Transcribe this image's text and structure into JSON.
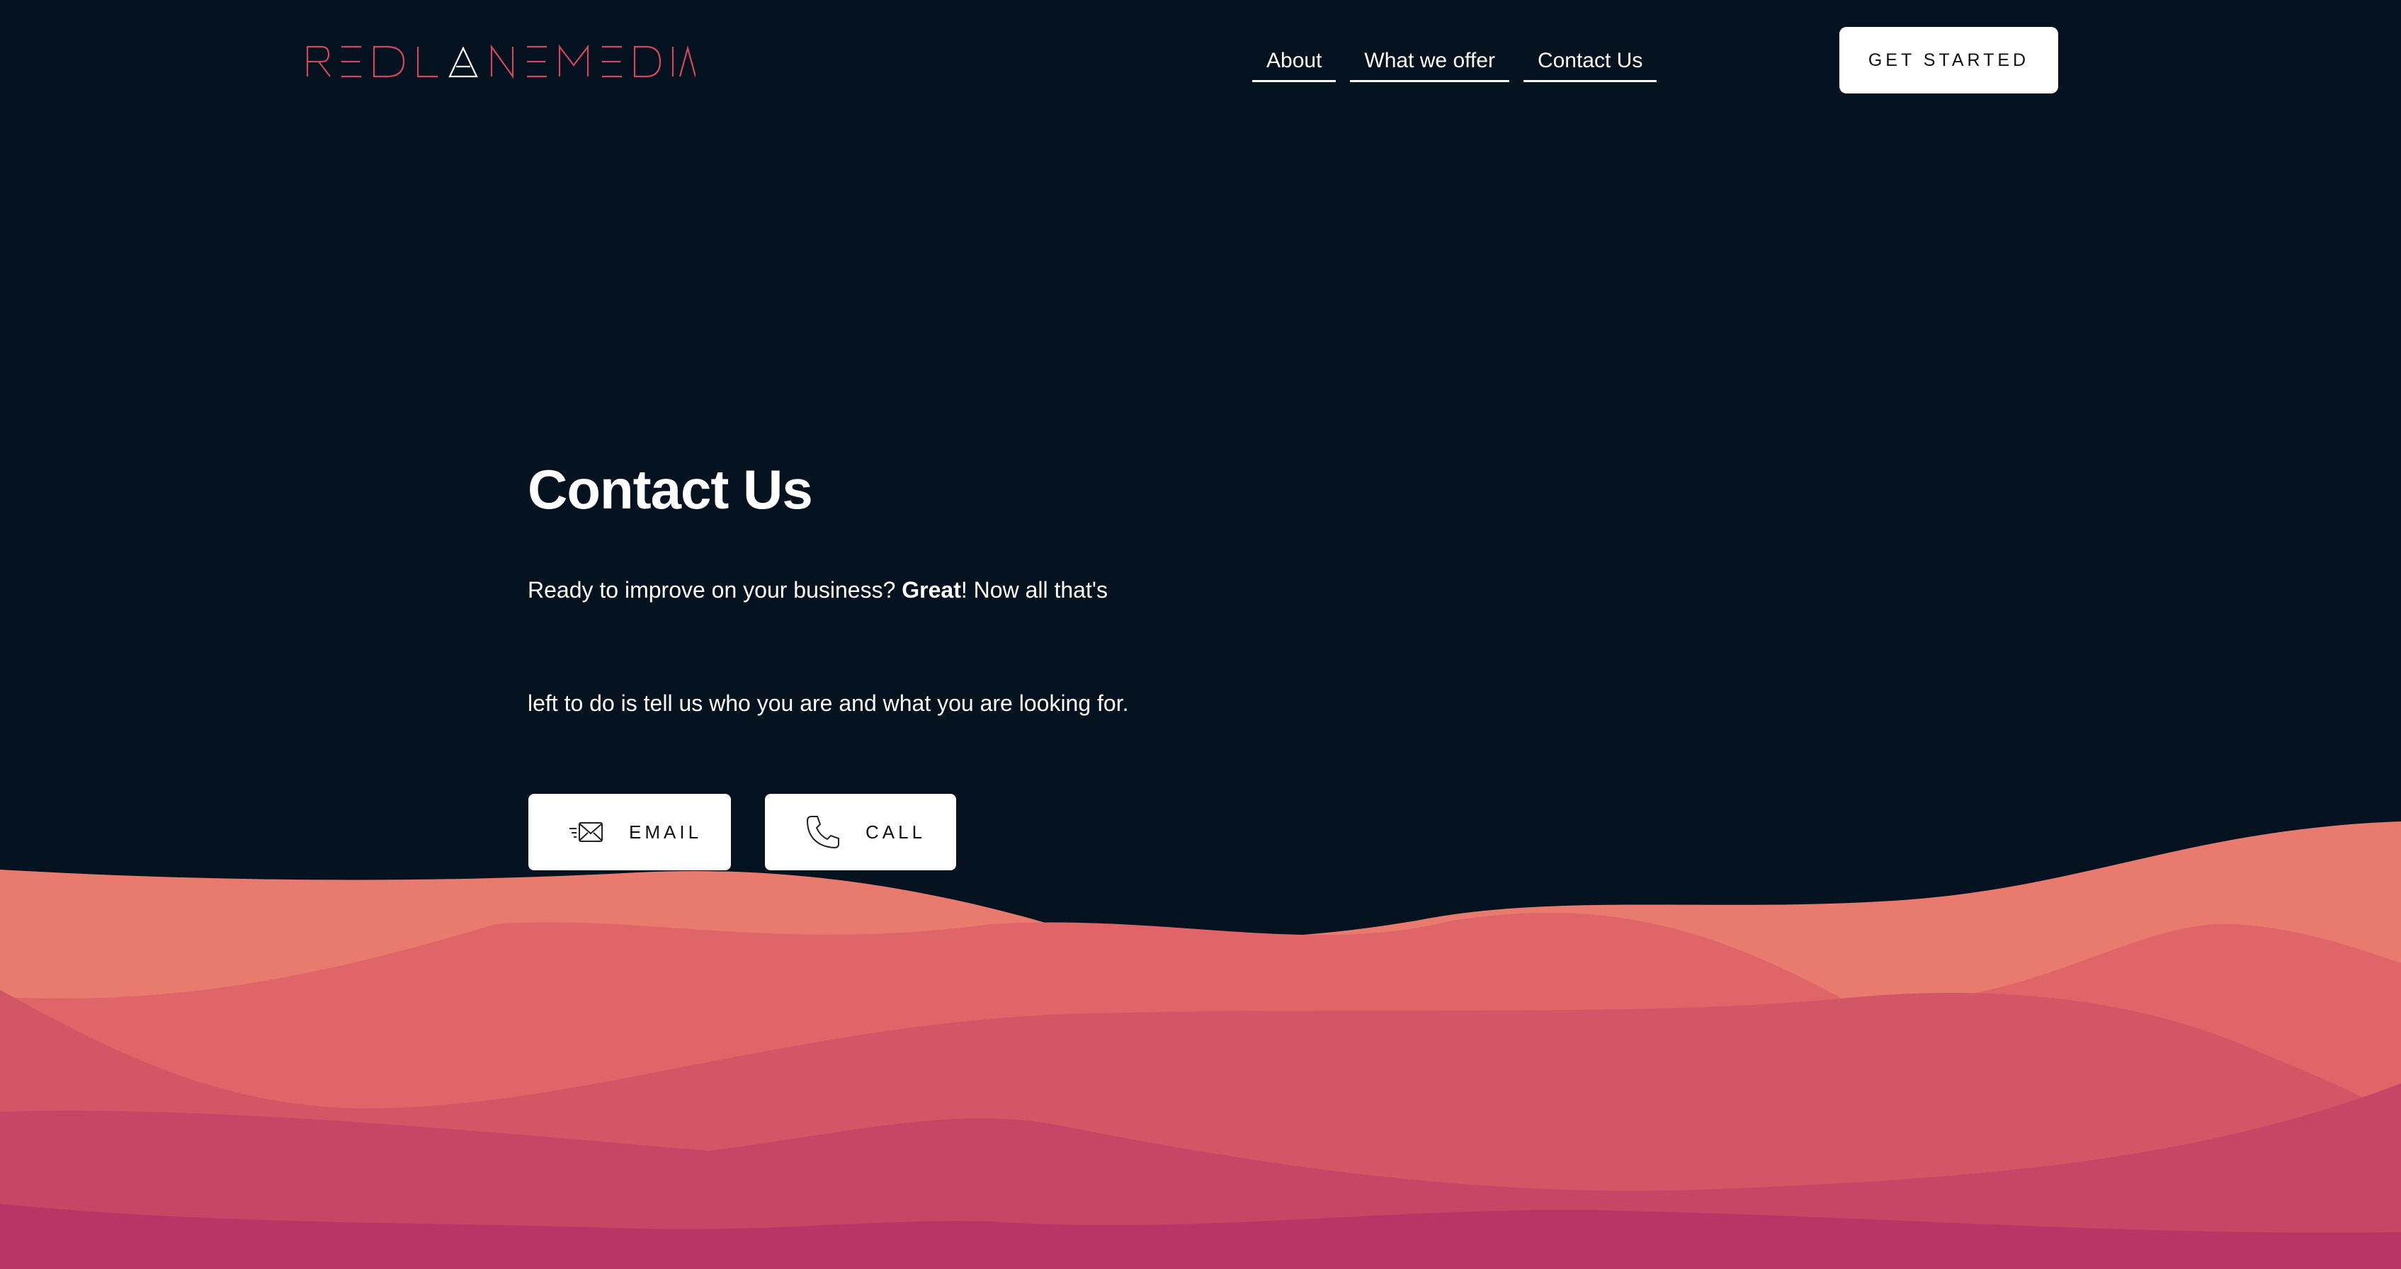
{
  "header": {
    "logo_text": "REDLANEMEDIA",
    "nav": [
      {
        "label": "About"
      },
      {
        "label": "What we offer"
      },
      {
        "label": "Contact Us"
      }
    ],
    "cta_label": "GET STARTED"
  },
  "hero": {
    "title": "Contact Us",
    "line1_before": "Ready to improve on your business? ",
    "line1_bold": "Great",
    "line1_after": "! Now all that's",
    "line2": "left to do is tell us who you are and what you are looking for.",
    "buttons": {
      "email_label": "EMAIL",
      "call_label": "CALL"
    }
  },
  "icons": {
    "email": "email-fast-icon",
    "call": "phone-icon"
  },
  "colors": {
    "background": "#04111f",
    "logo": "#d2485a",
    "wave_1": "#e87a6e",
    "wave_2": "#df6569",
    "wave_3": "#d35667",
    "wave_4": "#c74565",
    "wave_5": "#b83565",
    "button_bg": "#ffffff"
  }
}
